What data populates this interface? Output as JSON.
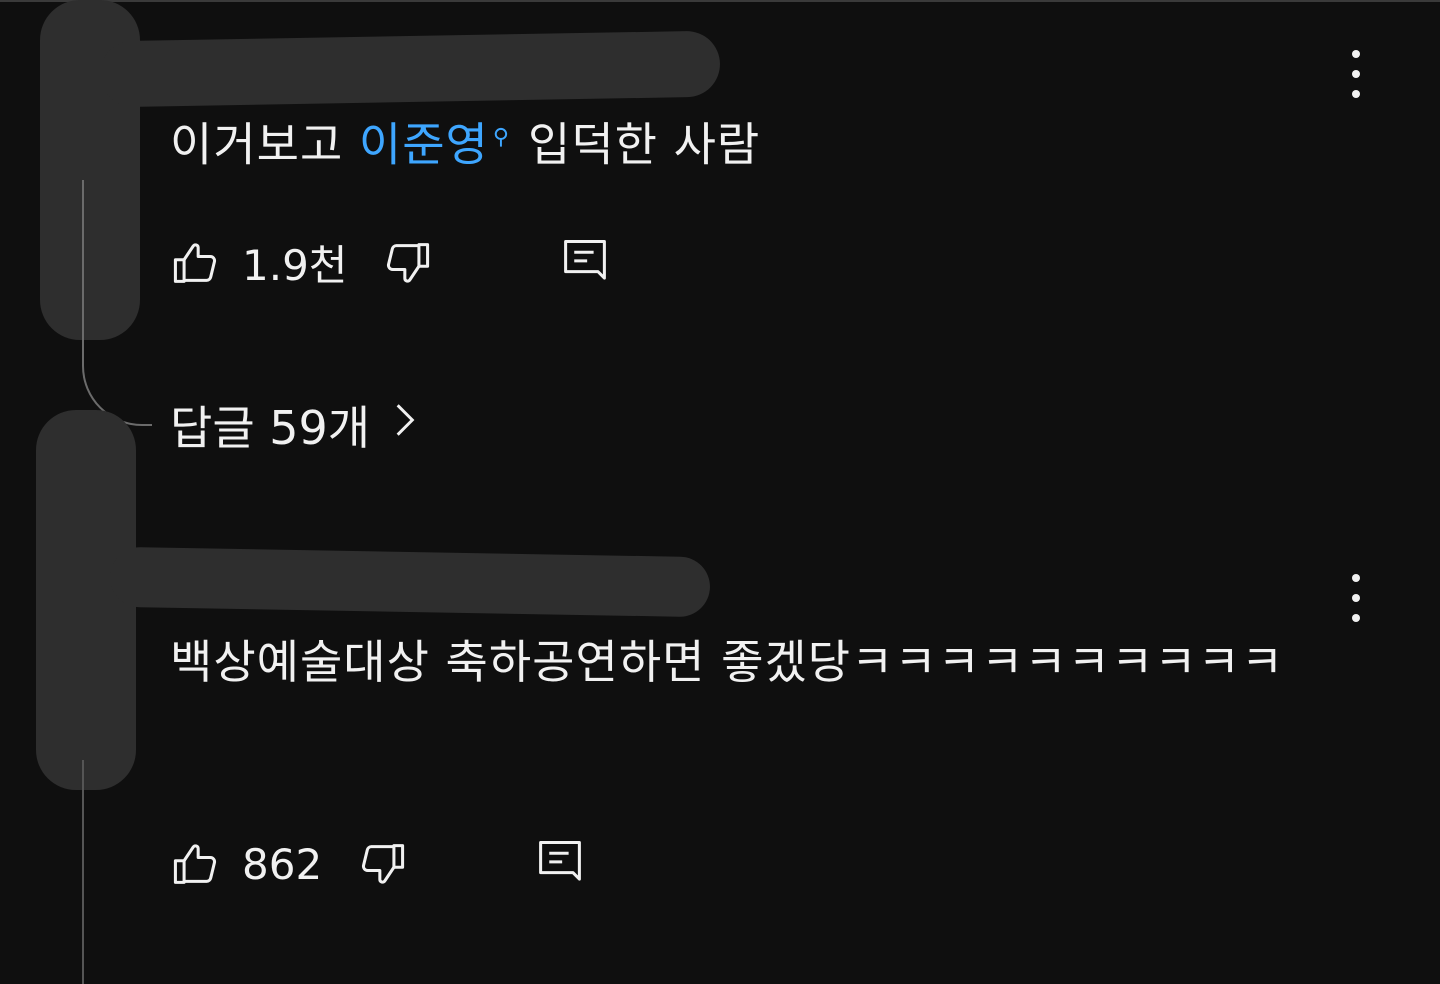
{
  "comments": [
    {
      "text_before": "이거보고 ",
      "mention": "이준영",
      "text_after": "입덕한 사람",
      "like_count": "1.9천"
    },
    {
      "text": "백상예술대상 축하공연하면 좋겠당ㅋㅋㅋㅋㅋㅋㅋㅋㅋㅋ",
      "like_count": "862"
    }
  ],
  "replies": {
    "label": "답글 59개"
  },
  "icons": {
    "like": "thumbs-up-icon",
    "dislike": "thumbs-down-icon",
    "reply": "reply-icon",
    "more": "more-vert-icon",
    "chevron": "chevron-right-icon"
  },
  "colors": {
    "background": "#0f0f0f",
    "text": "#f1f1f1",
    "mention": "#3ea6ff"
  }
}
